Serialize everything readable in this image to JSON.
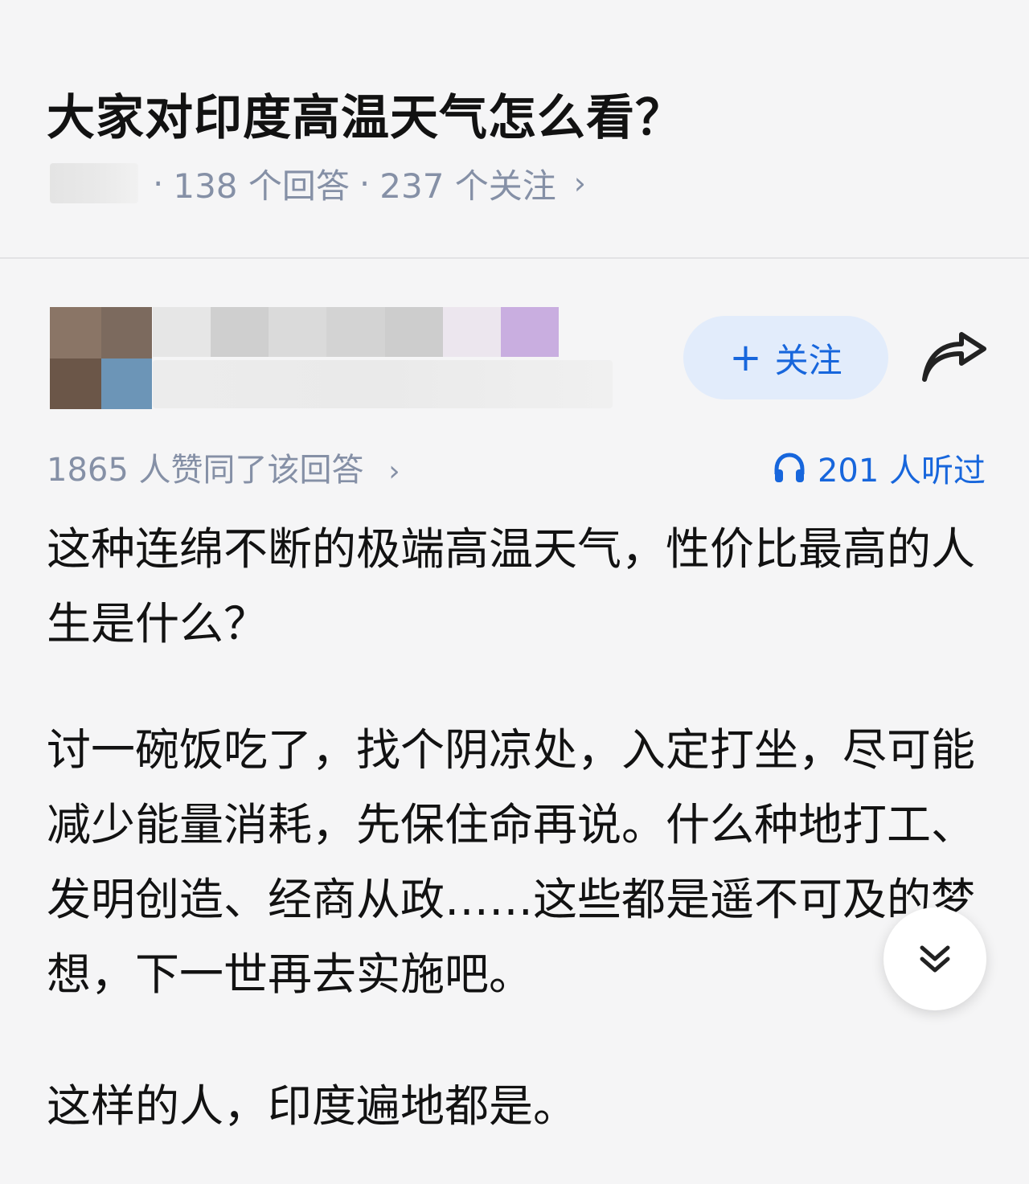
{
  "question": {
    "title": "大家对印度高温天气怎么看？",
    "answers_count": "138 个回答",
    "followers_count": "237 个关注",
    "separator": "·",
    "chevron": "›"
  },
  "answer": {
    "follow_button": {
      "icon": "+",
      "label": "关注"
    },
    "share_icon": "share-arrow-icon",
    "votes_text": "1865 人赞同了该回答",
    "votes_chevron": "›",
    "listened_text": "201 人听过",
    "listen_icon": "headphones-icon",
    "paragraphs": [
      "这种连绵不断的极端高温天气，性价比最高的人生是什么？",
      "讨一碗饭吃了，找个阴凉处，入定打坐，尽可能减少能量消耗，先保住命再说。什么种地打工、发明创造、经商从政……这些都是遥不可及的梦想，下一世再去实施吧。",
      "这样的人，印度遍地都是。"
    ]
  },
  "scroll_down_button": {
    "icon": "double-chevron-down-icon"
  },
  "colors": {
    "accent_blue": "#1766dc",
    "follow_bg": "#e2ecfb",
    "muted_text": "#8590a6",
    "background": "#f5f5f6"
  }
}
